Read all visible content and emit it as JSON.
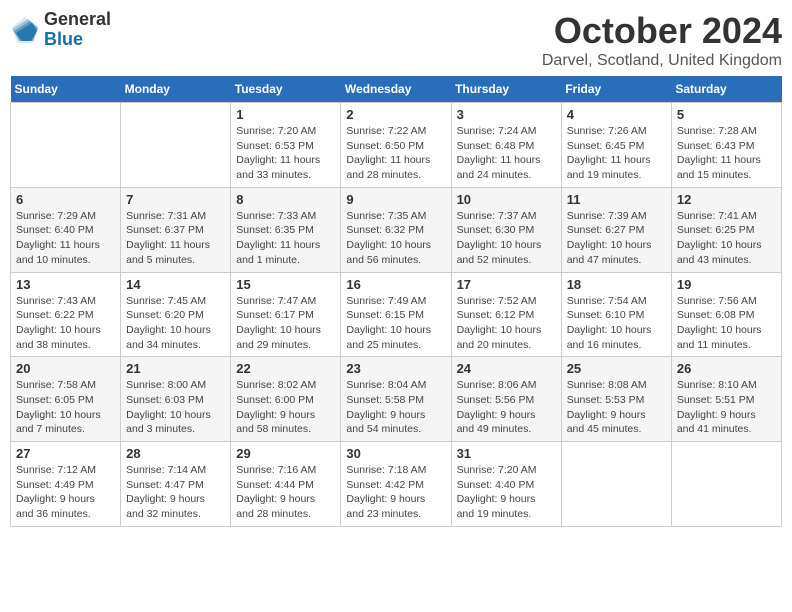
{
  "header": {
    "logo_general": "General",
    "logo_blue": "Blue",
    "title": "October 2024",
    "subtitle": "Darvel, Scotland, United Kingdom"
  },
  "days_of_week": [
    "Sunday",
    "Monday",
    "Tuesday",
    "Wednesday",
    "Thursday",
    "Friday",
    "Saturday"
  ],
  "weeks": [
    [
      {
        "day": "",
        "info": ""
      },
      {
        "day": "",
        "info": ""
      },
      {
        "day": "1",
        "info": "Sunrise: 7:20 AM\nSunset: 6:53 PM\nDaylight: 11 hours\nand 33 minutes."
      },
      {
        "day": "2",
        "info": "Sunrise: 7:22 AM\nSunset: 6:50 PM\nDaylight: 11 hours\nand 28 minutes."
      },
      {
        "day": "3",
        "info": "Sunrise: 7:24 AM\nSunset: 6:48 PM\nDaylight: 11 hours\nand 24 minutes."
      },
      {
        "day": "4",
        "info": "Sunrise: 7:26 AM\nSunset: 6:45 PM\nDaylight: 11 hours\nand 19 minutes."
      },
      {
        "day": "5",
        "info": "Sunrise: 7:28 AM\nSunset: 6:43 PM\nDaylight: 11 hours\nand 15 minutes."
      }
    ],
    [
      {
        "day": "6",
        "info": "Sunrise: 7:29 AM\nSunset: 6:40 PM\nDaylight: 11 hours\nand 10 minutes."
      },
      {
        "day": "7",
        "info": "Sunrise: 7:31 AM\nSunset: 6:37 PM\nDaylight: 11 hours\nand 5 minutes."
      },
      {
        "day": "8",
        "info": "Sunrise: 7:33 AM\nSunset: 6:35 PM\nDaylight: 11 hours\nand 1 minute."
      },
      {
        "day": "9",
        "info": "Sunrise: 7:35 AM\nSunset: 6:32 PM\nDaylight: 10 hours\nand 56 minutes."
      },
      {
        "day": "10",
        "info": "Sunrise: 7:37 AM\nSunset: 6:30 PM\nDaylight: 10 hours\nand 52 minutes."
      },
      {
        "day": "11",
        "info": "Sunrise: 7:39 AM\nSunset: 6:27 PM\nDaylight: 10 hours\nand 47 minutes."
      },
      {
        "day": "12",
        "info": "Sunrise: 7:41 AM\nSunset: 6:25 PM\nDaylight: 10 hours\nand 43 minutes."
      }
    ],
    [
      {
        "day": "13",
        "info": "Sunrise: 7:43 AM\nSunset: 6:22 PM\nDaylight: 10 hours\nand 38 minutes."
      },
      {
        "day": "14",
        "info": "Sunrise: 7:45 AM\nSunset: 6:20 PM\nDaylight: 10 hours\nand 34 minutes."
      },
      {
        "day": "15",
        "info": "Sunrise: 7:47 AM\nSunset: 6:17 PM\nDaylight: 10 hours\nand 29 minutes."
      },
      {
        "day": "16",
        "info": "Sunrise: 7:49 AM\nSunset: 6:15 PM\nDaylight: 10 hours\nand 25 minutes."
      },
      {
        "day": "17",
        "info": "Sunrise: 7:52 AM\nSunset: 6:12 PM\nDaylight: 10 hours\nand 20 minutes."
      },
      {
        "day": "18",
        "info": "Sunrise: 7:54 AM\nSunset: 6:10 PM\nDaylight: 10 hours\nand 16 minutes."
      },
      {
        "day": "19",
        "info": "Sunrise: 7:56 AM\nSunset: 6:08 PM\nDaylight: 10 hours\nand 11 minutes."
      }
    ],
    [
      {
        "day": "20",
        "info": "Sunrise: 7:58 AM\nSunset: 6:05 PM\nDaylight: 10 hours\nand 7 minutes."
      },
      {
        "day": "21",
        "info": "Sunrise: 8:00 AM\nSunset: 6:03 PM\nDaylight: 10 hours\nand 3 minutes."
      },
      {
        "day": "22",
        "info": "Sunrise: 8:02 AM\nSunset: 6:00 PM\nDaylight: 9 hours\nand 58 minutes."
      },
      {
        "day": "23",
        "info": "Sunrise: 8:04 AM\nSunset: 5:58 PM\nDaylight: 9 hours\nand 54 minutes."
      },
      {
        "day": "24",
        "info": "Sunrise: 8:06 AM\nSunset: 5:56 PM\nDaylight: 9 hours\nand 49 minutes."
      },
      {
        "day": "25",
        "info": "Sunrise: 8:08 AM\nSunset: 5:53 PM\nDaylight: 9 hours\nand 45 minutes."
      },
      {
        "day": "26",
        "info": "Sunrise: 8:10 AM\nSunset: 5:51 PM\nDaylight: 9 hours\nand 41 minutes."
      }
    ],
    [
      {
        "day": "27",
        "info": "Sunrise: 7:12 AM\nSunset: 4:49 PM\nDaylight: 9 hours\nand 36 minutes."
      },
      {
        "day": "28",
        "info": "Sunrise: 7:14 AM\nSunset: 4:47 PM\nDaylight: 9 hours\nand 32 minutes."
      },
      {
        "day": "29",
        "info": "Sunrise: 7:16 AM\nSunset: 4:44 PM\nDaylight: 9 hours\nand 28 minutes."
      },
      {
        "day": "30",
        "info": "Sunrise: 7:18 AM\nSunset: 4:42 PM\nDaylight: 9 hours\nand 23 minutes."
      },
      {
        "day": "31",
        "info": "Sunrise: 7:20 AM\nSunset: 4:40 PM\nDaylight: 9 hours\nand 19 minutes."
      },
      {
        "day": "",
        "info": ""
      },
      {
        "day": "",
        "info": ""
      }
    ]
  ]
}
